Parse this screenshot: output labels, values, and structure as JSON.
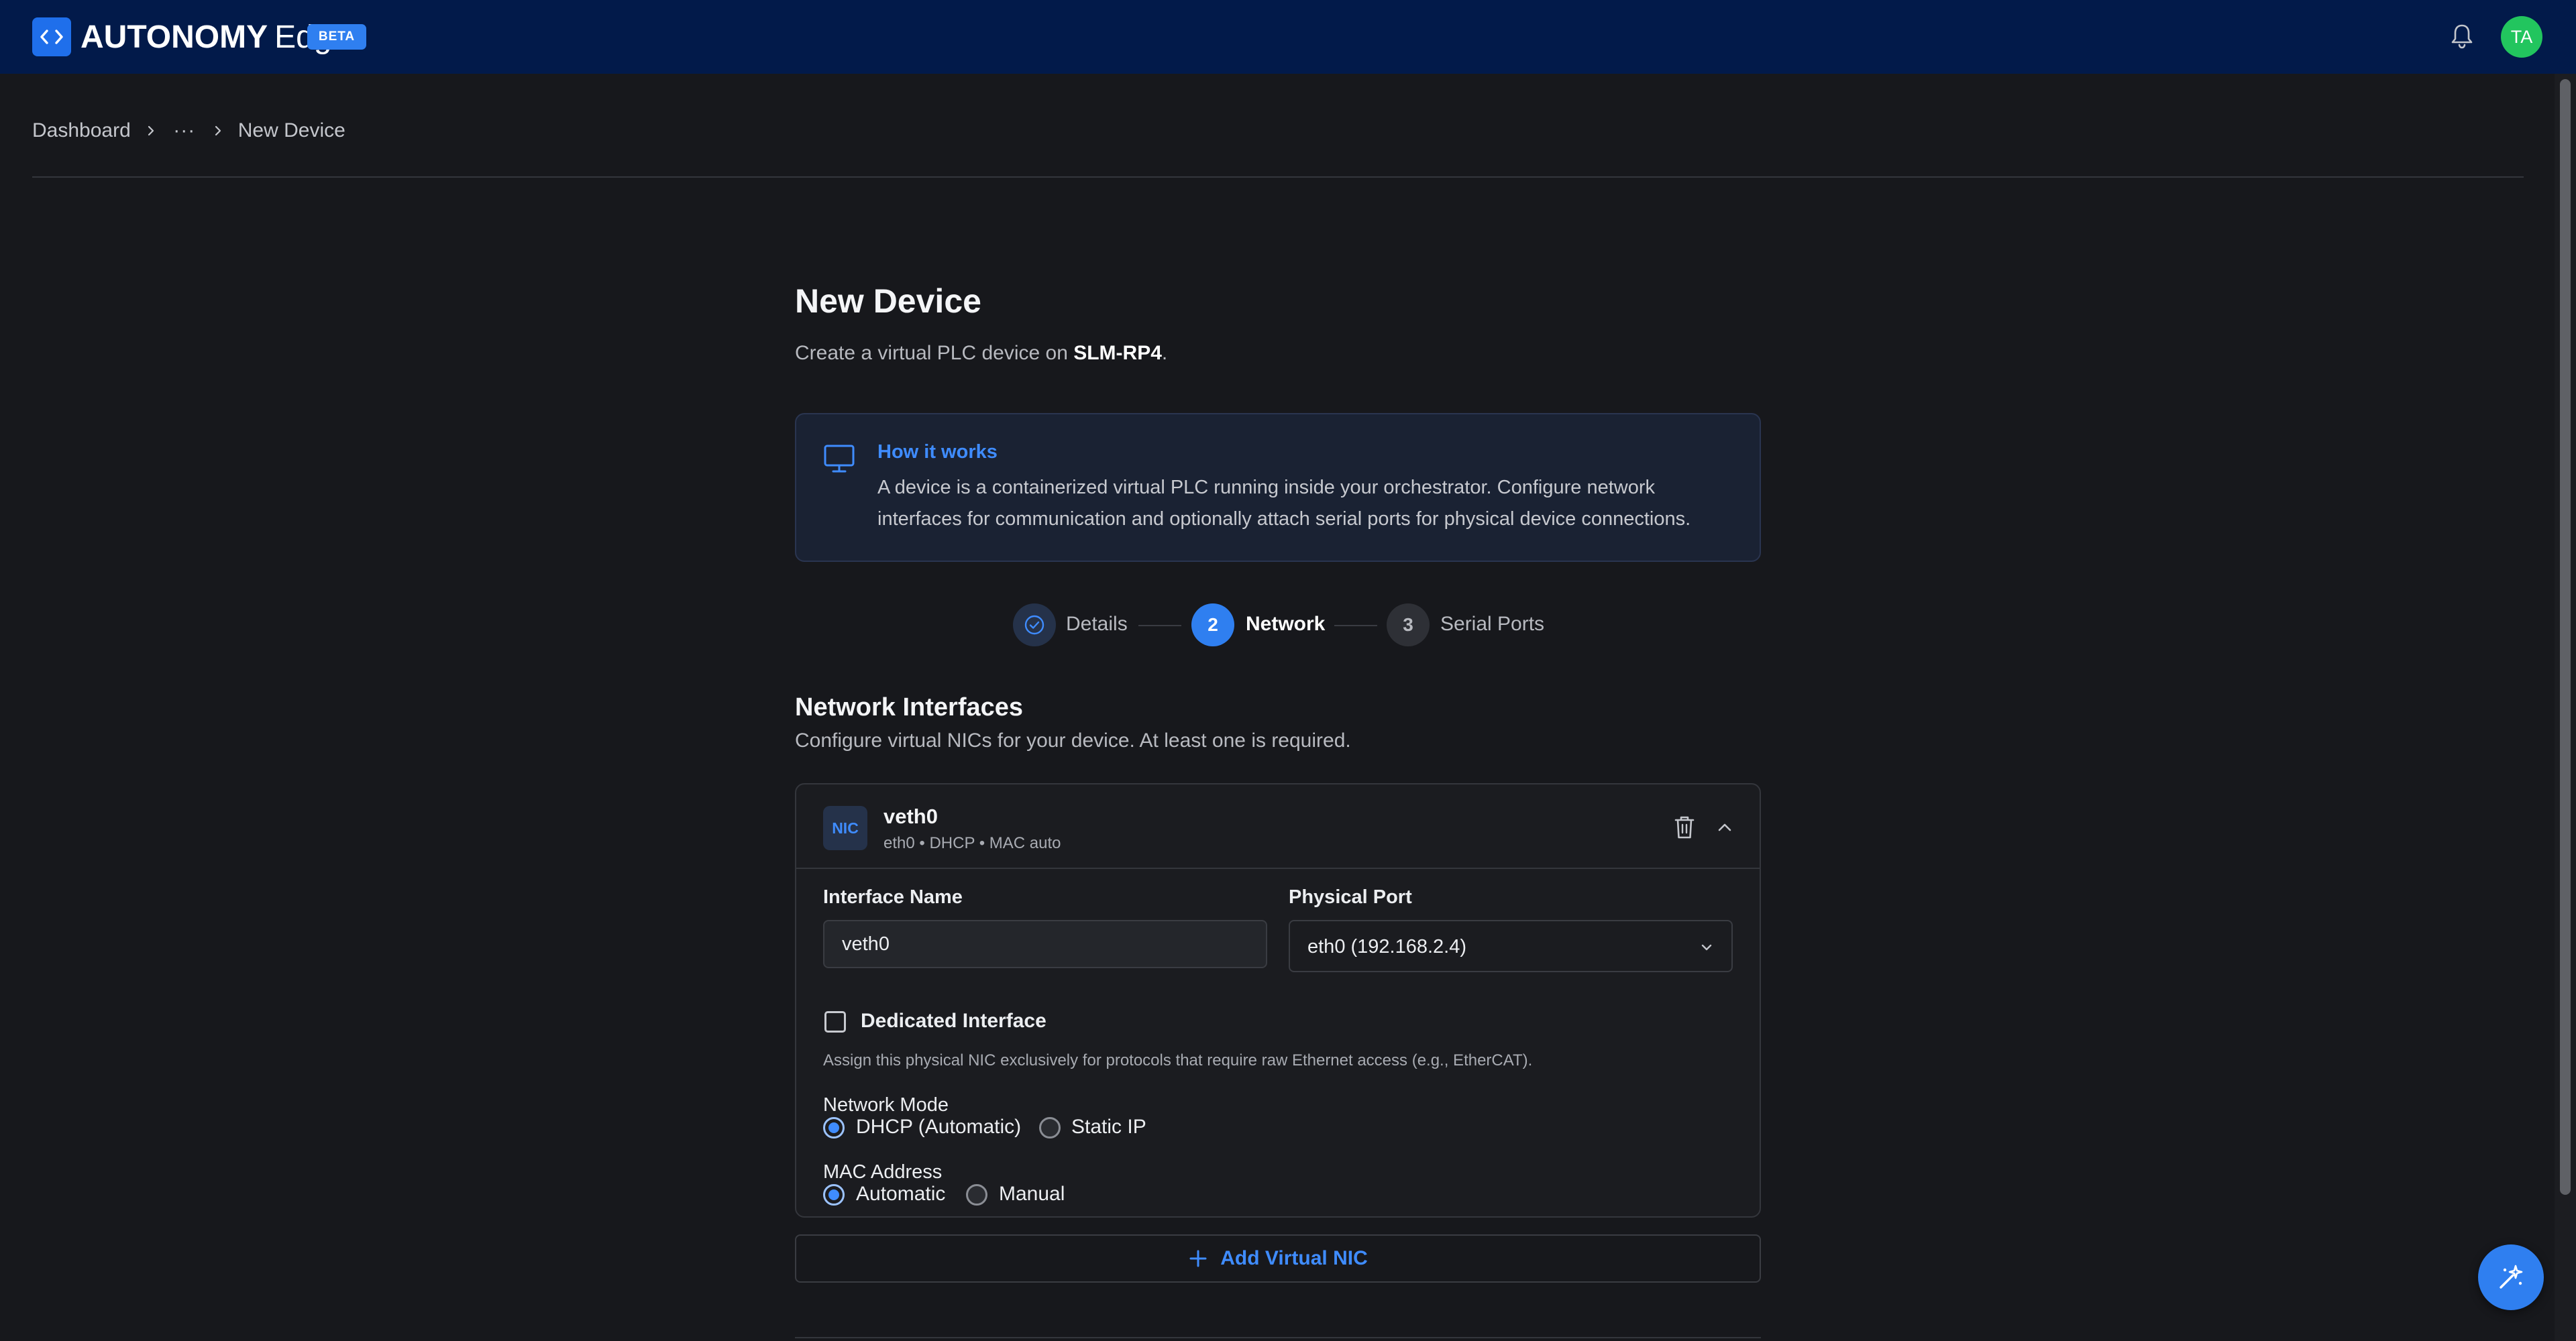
{
  "header": {
    "brand_strong": "AUTONOMY",
    "brand_light": "Edge",
    "beta_label": "BETA",
    "avatar_initials": "TA",
    "icons": {
      "logo": "code-brackets-icon",
      "bell": "bell-icon"
    }
  },
  "breadcrumb": {
    "items": [
      "Dashboard",
      "···",
      "New Device"
    ]
  },
  "page": {
    "title": "New Device",
    "subtitle_prefix": "Create a virtual PLC device on ",
    "subtitle_device": "SLM-RP4",
    "subtitle_suffix": "."
  },
  "info": {
    "title": "How it works",
    "text": "A device is a containerized virtual PLC running inside your orchestrator. Configure network interfaces for communication and optionally attach serial ports for physical device connections.",
    "icon": "monitor-icon"
  },
  "stepper": {
    "steps": [
      {
        "number": "",
        "label": "Details",
        "state": "completed"
      },
      {
        "number": "2",
        "label": "Network",
        "state": "active"
      },
      {
        "number": "3",
        "label": "Serial Ports",
        "state": "upcoming"
      }
    ]
  },
  "network": {
    "title": "Network Interfaces",
    "subtitle": "Configure virtual NICs for your device. At least one is required.",
    "nic": {
      "badge": "NIC",
      "name": "veth0",
      "meta": "eth0 • DHCP • MAC auto",
      "interface_name_label": "Interface Name",
      "interface_name_value": "veth0",
      "physical_port_label": "Physical Port",
      "physical_port_value": "eth0 (192.168.2.4)",
      "dedicated_label": "Dedicated Interface",
      "dedicated_checked": false,
      "dedicated_help": "Assign this physical NIC exclusively for protocols that require raw Ethernet access (e.g., EtherCAT).",
      "network_mode_label": "Network Mode",
      "network_mode_options": [
        "DHCP (Automatic)",
        "Static IP"
      ],
      "network_mode_selected": "DHCP (Automatic)",
      "mac_label": "MAC Address",
      "mac_options": [
        "Automatic",
        "Manual"
      ],
      "mac_selected": "Automatic"
    },
    "add_nic_label": "Add Virtual NIC"
  },
  "colors": {
    "header_bg": "#021a4a",
    "accent": "#3f8cff",
    "page_bg": "#17181c",
    "avatar_bg": "#22c55e"
  }
}
